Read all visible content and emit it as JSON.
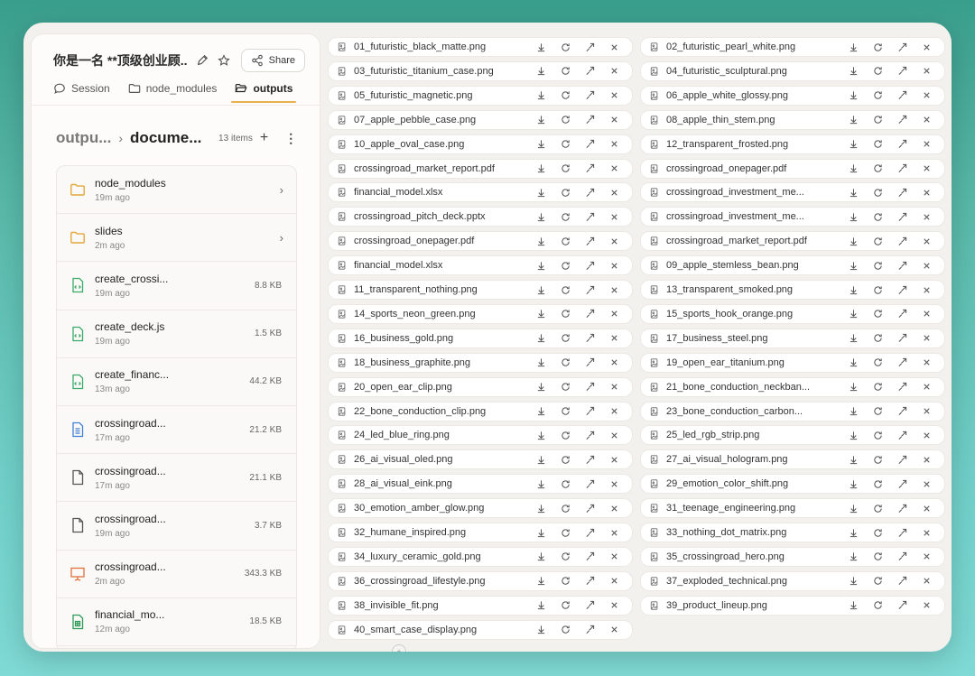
{
  "header": {
    "title": "你是一名 **顶级创业顾...",
    "share_label": "Share"
  },
  "tabs": [
    {
      "label": "Session",
      "icon": "chat-bubble-icon",
      "active": false
    },
    {
      "label": "node_modules",
      "icon": "folder-icon",
      "active": false
    },
    {
      "label": "outputs",
      "icon": "folder-open-icon",
      "active": true
    }
  ],
  "breadcrumb": {
    "parent": "outpu...",
    "current": "docume...",
    "count": "13 items"
  },
  "files": [
    {
      "name": "node_modules",
      "age": "19m ago",
      "type": "folder",
      "size": ""
    },
    {
      "name": "slides",
      "age": "2m ago",
      "type": "folder",
      "size": ""
    },
    {
      "name": "create_crossi...",
      "age": "19m ago",
      "type": "code",
      "size": "8.8 KB"
    },
    {
      "name": "create_deck.js",
      "age": "19m ago",
      "type": "code",
      "size": "1.5 KB"
    },
    {
      "name": "create_financ...",
      "age": "13m ago",
      "type": "code",
      "size": "44.2 KB"
    },
    {
      "name": "crossingroad...",
      "age": "17m ago",
      "type": "doc",
      "size": "21.2 KB"
    },
    {
      "name": "crossingroad...",
      "age": "17m ago",
      "type": "file",
      "size": "21.1 KB"
    },
    {
      "name": "crossingroad...",
      "age": "19m ago",
      "type": "file",
      "size": "3.7 KB"
    },
    {
      "name": "crossingroad...",
      "age": "2m ago",
      "type": "slides",
      "size": "343.3 KB"
    },
    {
      "name": "financial_mo...",
      "age": "12m ago",
      "type": "sheet",
      "size": "18.5 KB"
    }
  ],
  "grid_left": [
    "01_futuristic_black_matte.png",
    "03_futuristic_titanium_case.png",
    "05_futuristic_magnetic.png",
    "07_apple_pebble_case.png",
    "10_apple_oval_case.png",
    "crossingroad_market_report.pdf",
    "financial_model.xlsx",
    "crossingroad_pitch_deck.pptx",
    "crossingroad_onepager.pdf",
    "financial_model.xlsx",
    "11_transparent_nothing.png",
    "14_sports_neon_green.png",
    "16_business_gold.png",
    "18_business_graphite.png",
    "20_open_ear_clip.png",
    "22_bone_conduction_clip.png",
    "24_led_blue_ring.png",
    "26_ai_visual_oled.png",
    "28_ai_visual_eink.png",
    "30_emotion_amber_glow.png",
    "32_humane_inspired.png",
    "34_luxury_ceramic_gold.png",
    "36_crossingroad_lifestyle.png",
    "38_invisible_fit.png",
    "40_smart_case_display.png"
  ],
  "grid_right": [
    "02_futuristic_pearl_white.png",
    "04_futuristic_sculptural.png",
    "06_apple_white_glossy.png",
    "08_apple_thin_stem.png",
    "12_transparent_frosted.png",
    "crossingroad_onepager.pdf",
    "crossingroad_investment_me...",
    "crossingroad_investment_me...",
    "crossingroad_market_report.pdf",
    "09_apple_stemless_bean.png",
    "13_transparent_smoked.png",
    "15_sports_hook_orange.png",
    "17_business_steel.png",
    "19_open_ear_titanium.png",
    "21_bone_conduction_neckban...",
    "23_bone_conduction_carbon...",
    "25_led_rgb_strip.png",
    "27_ai_visual_hologram.png",
    "29_emotion_color_shift.png",
    "31_teenage_engineering.png",
    "33_nothing_dot_matrix.png",
    "35_crossingroad_hero.png",
    "37_exploded_technical.png",
    "39_product_lineup.png"
  ]
}
